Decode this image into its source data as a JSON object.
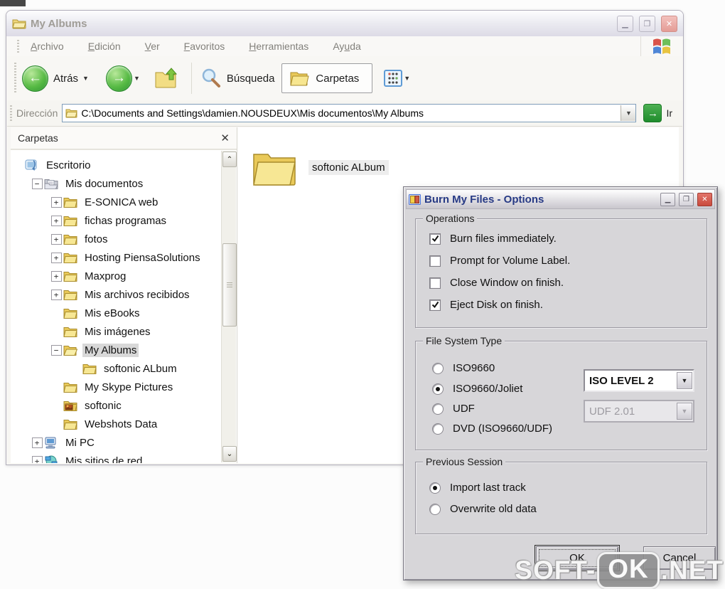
{
  "window": {
    "title": "My Albums",
    "menu": [
      {
        "label": "Archivo",
        "accel": 0
      },
      {
        "label": "Edición",
        "accel": 0
      },
      {
        "label": "Ver",
        "accel": 0
      },
      {
        "label": "Favoritos",
        "accel": 0
      },
      {
        "label": "Herramientas",
        "accel": 0
      },
      {
        "label": "Ayuda",
        "accel": 2
      }
    ],
    "toolbar": {
      "back_label": "Atrás",
      "search_label": "Búsqueda",
      "folders_label": "Carpetas"
    },
    "address": {
      "label": "Dirección",
      "path": "C:\\Documents and Settings\\damien.NOUSDEUX\\Mis documentos\\My Albums",
      "go_label": "Ir"
    },
    "folders_pane_title": "Carpetas",
    "tree": [
      {
        "label": "Escritorio",
        "depth": 0,
        "expander": "none",
        "icon": "desktop-icon",
        "selected": false
      },
      {
        "label": "Mis documentos",
        "depth": 1,
        "expander": "minus",
        "icon": "my-documents-icon",
        "selected": false
      },
      {
        "label": "E-SONICA web",
        "depth": 2,
        "expander": "plus",
        "icon": "folder-icon",
        "selected": false
      },
      {
        "label": "fichas programas",
        "depth": 2,
        "expander": "plus",
        "icon": "folder-icon",
        "selected": false
      },
      {
        "label": "fotos",
        "depth": 2,
        "expander": "plus",
        "icon": "folder-icon",
        "selected": false
      },
      {
        "label": "Hosting PiensaSolutions",
        "depth": 2,
        "expander": "plus",
        "icon": "folder-icon",
        "selected": false
      },
      {
        "label": "Maxprog",
        "depth": 2,
        "expander": "plus",
        "icon": "folder-icon",
        "selected": false
      },
      {
        "label": "Mis archivos recibidos",
        "depth": 2,
        "expander": "plus",
        "icon": "folder-icon",
        "selected": false
      },
      {
        "label": "Mis eBooks",
        "depth": 2,
        "expander": "none",
        "icon": "folder-icon",
        "selected": false
      },
      {
        "label": "Mis imágenes",
        "depth": 2,
        "expander": "none",
        "icon": "folder-icon",
        "selected": false
      },
      {
        "label": "My Albums",
        "depth": 2,
        "expander": "minus",
        "icon": "folder-open-icon",
        "selected": true
      },
      {
        "label": "softonic ALbum",
        "depth": 3,
        "expander": "none",
        "icon": "folder-icon",
        "selected": false
      },
      {
        "label": "My Skype Pictures",
        "depth": 2,
        "expander": "none",
        "icon": "folder-icon",
        "selected": false
      },
      {
        "label": "softonic",
        "depth": 2,
        "expander": "none",
        "icon": "pictures-folder-icon",
        "selected": false
      },
      {
        "label": "Webshots Data",
        "depth": 2,
        "expander": "none",
        "icon": "folder-icon",
        "selected": false
      },
      {
        "label": "Mi PC",
        "depth": 1,
        "expander": "plus",
        "icon": "computer-icon",
        "selected": false
      },
      {
        "label": "Mis sitios de red",
        "depth": 1,
        "expander": "plus",
        "icon": "network-icon",
        "selected": false
      }
    ],
    "files": [
      {
        "label": "softonic ALbum",
        "icon": "folder-icon"
      }
    ]
  },
  "dialog": {
    "title": "Burn My Files - Options",
    "groups": {
      "operations": {
        "label": "Operations",
        "checkboxes": [
          {
            "label": "Burn files immediately.",
            "checked": true
          },
          {
            "label": "Prompt for Volume Label.",
            "checked": false
          },
          {
            "label": "Close Window on finish.",
            "checked": false
          },
          {
            "label": "Eject Disk on finish.",
            "checked": true
          }
        ]
      },
      "file_system": {
        "label": "File System Type",
        "radios": [
          {
            "label": "ISO9660",
            "selected": false
          },
          {
            "label": "ISO9660/Joliet",
            "selected": true
          },
          {
            "label": "UDF",
            "selected": false
          },
          {
            "label": "DVD (ISO9660/UDF)",
            "selected": false
          }
        ],
        "combos": [
          {
            "value": "ISO LEVEL 2",
            "disabled": false
          },
          {
            "value": "UDF 2.01",
            "disabled": true
          }
        ]
      },
      "previous_session": {
        "label": "Previous Session",
        "radios": [
          {
            "label": "Import last track",
            "selected": true
          },
          {
            "label": "Overwrite old data",
            "selected": false
          }
        ]
      }
    },
    "buttons": {
      "ok": "OK",
      "cancel": "Cancel"
    }
  },
  "watermark": {
    "part1": "SOFT-",
    "badge": "OK",
    "part2": ".NET"
  },
  "colors": {
    "titlebar_text": "#a09d97",
    "dialog_title_text": "#273a85",
    "nav_green": "#2f9e30",
    "go_green": "#1f8c2c",
    "close_red": "#c94a3d",
    "selection_gray": "#d8d8d8"
  }
}
